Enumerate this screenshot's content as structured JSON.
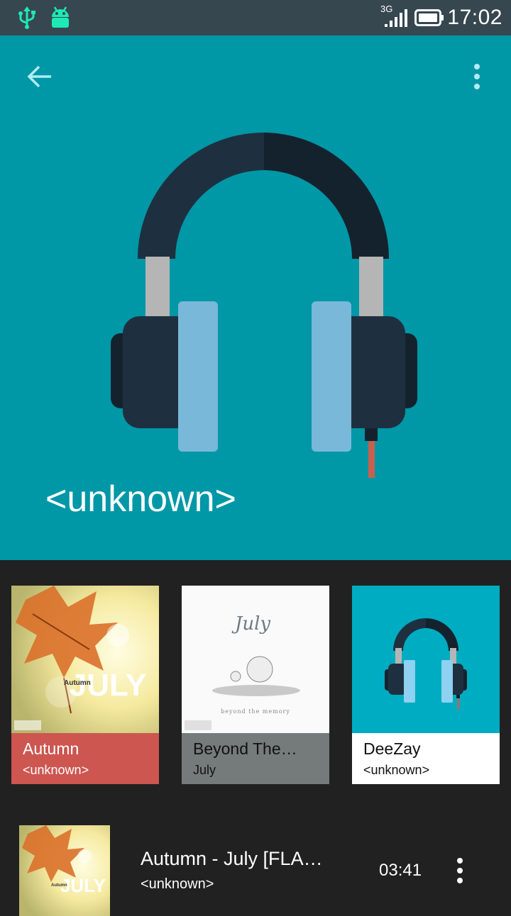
{
  "status_bar": {
    "network_type": "3G",
    "time": "17:02",
    "icons": [
      "usb-icon",
      "android-debug-icon",
      "signal-icon",
      "battery-icon"
    ]
  },
  "header": {
    "title": "<unknown>",
    "back_icon": "arrow-left-icon",
    "menu_icon": "more-vert-icon",
    "background_color": "#0097A7"
  },
  "albums": [
    {
      "title": "Autumn",
      "subtitle": "<unknown>",
      "cover_text": "JULY",
      "cover_subtext": "Autumn",
      "meta_color": "#CD5650",
      "text_color": "#FFFFFF"
    },
    {
      "title": "Beyond The…",
      "subtitle": "July",
      "cover_text": "July",
      "cover_subtext": "beyond the memory",
      "meta_color": "#757B7B",
      "text_color": "#111111"
    },
    {
      "title": "DeeZay",
      "subtitle": "<unknown>",
      "meta_color": "#FFFFFF",
      "text_color": "#111111"
    }
  ],
  "now_playing": {
    "song": "Autumn - July [FLAC…",
    "artist": "<unknown>",
    "duration": "03:41",
    "cover_text": "JULY",
    "cover_subtext": "Autumn",
    "menu_icon": "more-vert-icon"
  }
}
